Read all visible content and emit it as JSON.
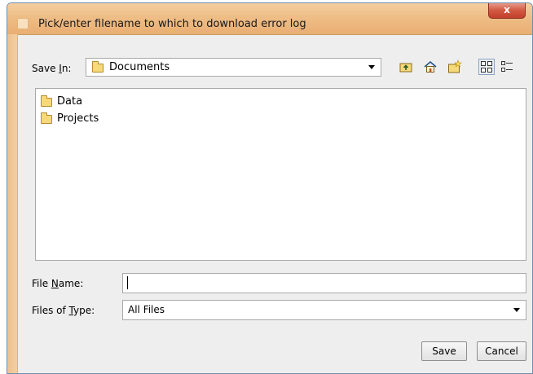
{
  "window": {
    "title": "Pick/enter filename to which to download error log",
    "close_glyph": "x"
  },
  "save_in": {
    "label_prefix": "Save ",
    "label_mnemonic": "I",
    "label_suffix": "n:",
    "value": "Documents"
  },
  "toolbar": {
    "buttons": [
      "up-one-level-icon",
      "home-icon",
      "new-folder-icon",
      "list-view-icon",
      "details-view-icon"
    ]
  },
  "files": [
    {
      "name": "Data",
      "icon": "folder-icon"
    },
    {
      "name": "Projects",
      "icon": "folder-icon"
    }
  ],
  "file_name": {
    "label_prefix": "File ",
    "label_mnemonic": "N",
    "label_suffix": "ame:",
    "value": ""
  },
  "file_type": {
    "label_prefix": "Files of ",
    "label_mnemonic": "T",
    "label_suffix": "ype:",
    "value": "All Files"
  },
  "buttons": {
    "save": "Save",
    "cancel": "Cancel"
  },
  "colors": {
    "titlebar": "#eebd86",
    "close_button": "#d35a43",
    "folder": "#f6d97a",
    "window_bg": "#eeeeee"
  }
}
